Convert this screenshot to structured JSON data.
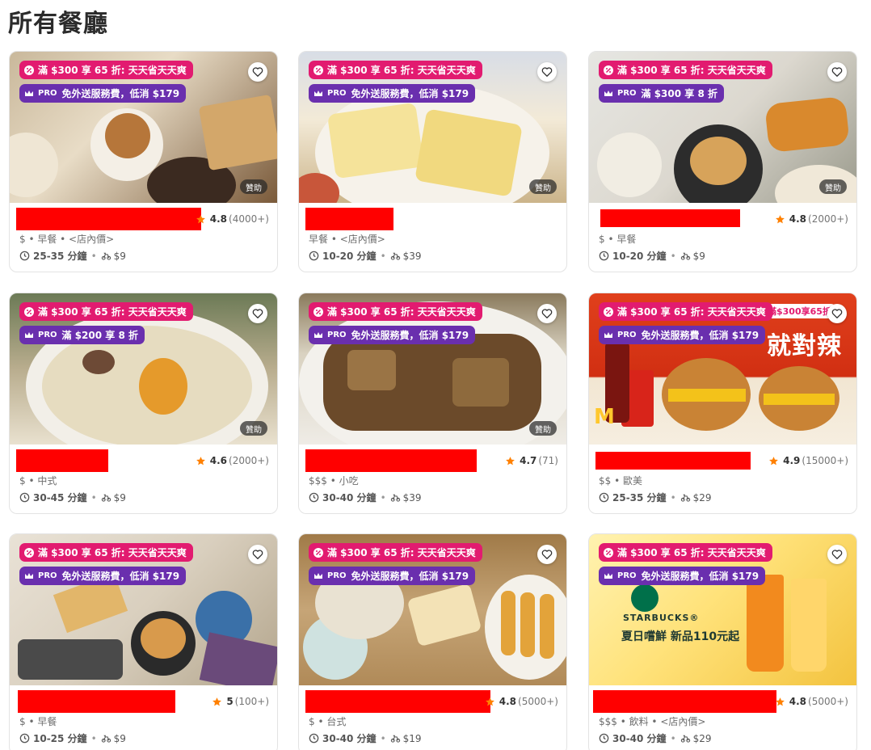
{
  "page_title": "所有餐廳",
  "colors": {
    "deal": "#e21b70",
    "pro": "#6a2fae",
    "redacted": "#ff0000",
    "star": "#ff8000"
  },
  "cards": [
    {
      "deal": "滿 $300 享 65 折: 天天省天天爽",
      "pro_label": "PRO",
      "pro": "免外送服務費，低消 $179",
      "sponsored": "贊助",
      "rating": "4.8",
      "count": "(4000+)",
      "meta": "$ • 早餐 • <店內價>",
      "time": "25-35 分鐘",
      "fee": "$9"
    },
    {
      "deal": "滿 $300 享 65 折: 天天省天天爽",
      "pro_label": "PRO",
      "pro": "免外送服務費，低消 $179",
      "sponsored": "贊助",
      "rating": "",
      "count": "",
      "meta": "早餐 • <店內價>",
      "time": "10-20 分鐘",
      "fee": "$39"
    },
    {
      "deal": "滿 $300 享 65 折: 天天省天天爽",
      "pro_label": "PRO",
      "pro": "滿 $300 享 8 折",
      "sponsored": "贊助",
      "rating": "4.8",
      "count": "(2000+)",
      "meta": "$ • 早餐",
      "time": "10-20 分鐘",
      "fee": "$9"
    },
    {
      "deal": "滿 $300 享 65 折: 天天省天天爽",
      "pro_label": "PRO",
      "pro": "滿 $200 享 8 折",
      "sponsored": "贊助",
      "rating": "4.6",
      "count": "(2000+)",
      "meta": "$ • 中式",
      "time": "30-45 分鐘",
      "fee": "$9"
    },
    {
      "deal": "滿 $300 享 65 折: 天天省天天爽",
      "pro_label": "PRO",
      "pro": "免外送服務費，低消 $179",
      "sponsored": "贊助",
      "rating": "4.7",
      "count": "(71)",
      "meta": "$$$ • 小吃",
      "time": "30-40 分鐘",
      "fee": "$39"
    },
    {
      "deal": "滿 $300 享 65 折: 天天省天天爽",
      "pro_label": "PRO",
      "pro": "免外送服務費，低消 $179",
      "sponsored": "",
      "rating": "4.9",
      "count": "(15000+)",
      "meta": "$$ • 歐美",
      "time": "25-35 分鐘",
      "fee": "$29",
      "overlay_badge": "滿$300享65折",
      "overlay_headline": "就對辣"
    },
    {
      "deal": "滿 $300 享 65 折: 天天省天天爽",
      "pro_label": "PRO",
      "pro": "免外送服務費，低消 $179",
      "sponsored": "",
      "rating": "5",
      "count": "(100+)",
      "meta": "$ • 早餐",
      "time": "10-25 分鐘",
      "fee": "$9"
    },
    {
      "deal": "滿 $300 享 65 折: 天天省天天爽",
      "pro_label": "PRO",
      "pro": "免外送服務費，低消 $179",
      "sponsored": "",
      "rating": "4.8",
      "count": "(5000+)",
      "meta": "$ • 台式",
      "time": "30-40 分鐘",
      "fee": "$19"
    },
    {
      "deal": "滿 $300 享 65 折: 天天省天天爽",
      "pro_label": "PRO",
      "pro": "免外送服務費，低消 $179",
      "sponsored": "",
      "rating": "4.8",
      "count": "(5000+)",
      "meta": "$$$ • 飲料 • <店內價>",
      "time": "30-40 分鐘",
      "fee": "$29",
      "overlay_brand": "STARBUCKS®",
      "overlay_tagline": "夏日嚐鮮 新品110元起"
    }
  ]
}
